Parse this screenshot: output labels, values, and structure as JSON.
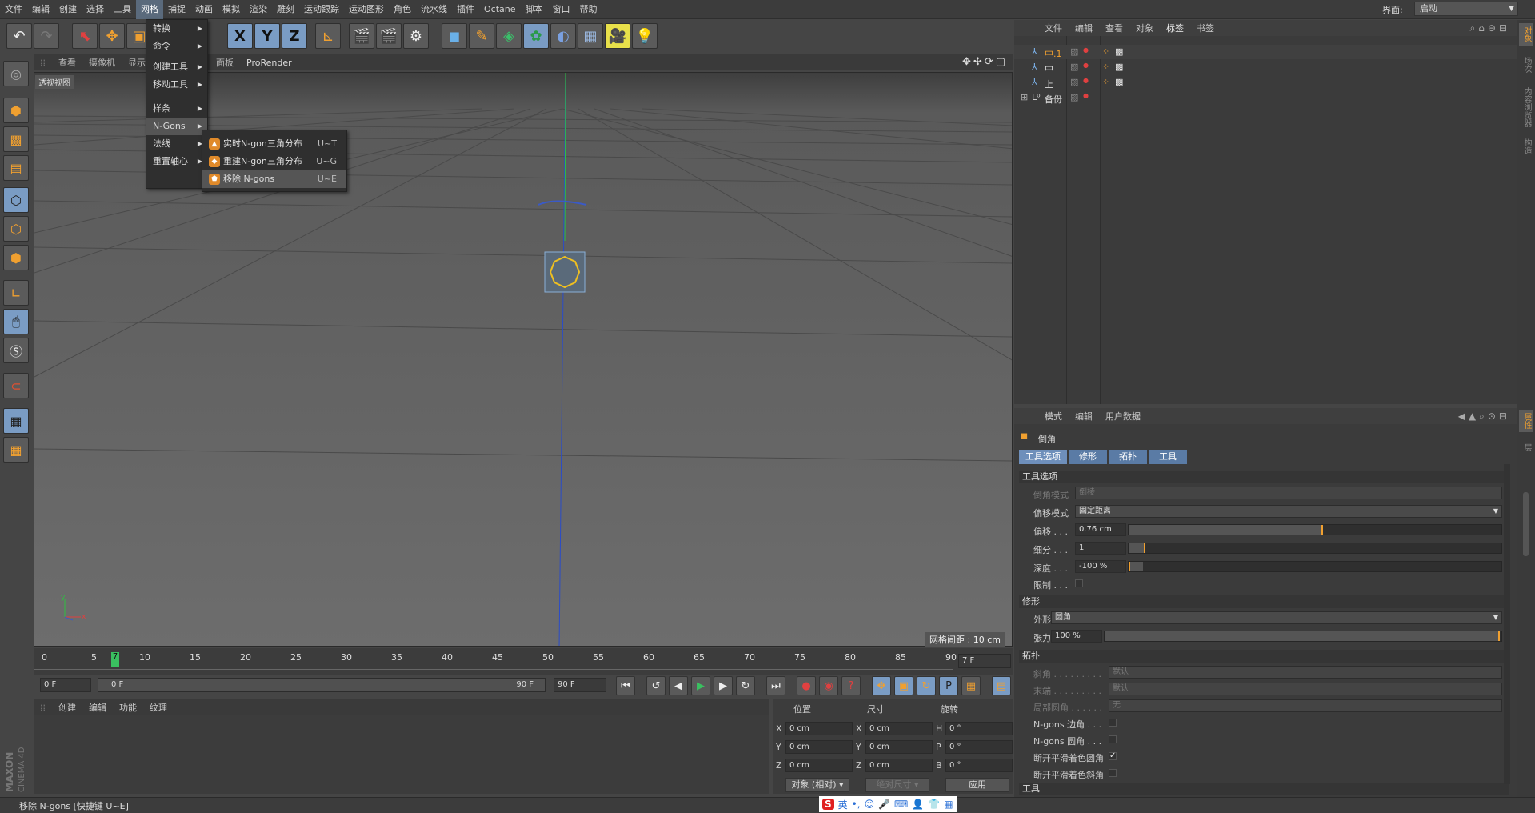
{
  "menubar": {
    "items": [
      "文件",
      "编辑",
      "创建",
      "选择",
      "工具",
      "网格",
      "捕捉",
      "动画",
      "模拟",
      "渲染",
      "雕刻",
      "运动跟踪",
      "运动图形",
      "角色",
      "流水线",
      "插件",
      "Octane",
      "脚本",
      "窗口",
      "帮助"
    ],
    "active_index": 5,
    "layout_label": "界面:",
    "layout_value": "启动"
  },
  "mesh_menu": {
    "items": [
      "转换",
      "命令",
      "创建工具",
      "移动工具",
      "样条",
      "N-Gons",
      "法线",
      "重置轴心"
    ],
    "highlight": "N-Gons"
  },
  "ngons_submenu": {
    "items": [
      {
        "label": "实时N-gon三角分布",
        "shortcut": "U~T"
      },
      {
        "label": "重建N-gon三角分布",
        "shortcut": "U~G"
      },
      {
        "label": "移除 N-gons",
        "shortcut": "U~E"
      }
    ]
  },
  "viewport": {
    "menu": [
      "查看",
      "摄像机",
      "显示",
      "面板",
      "ProRender"
    ],
    "label": "透视视图",
    "grid_info": "网格间距 : 10 cm",
    "axis_x": "x",
    "axis_y": "y"
  },
  "timeline": {
    "ticks": [
      "0",
      "5",
      "10",
      "15",
      "20",
      "25",
      "30",
      "35",
      "40",
      "45",
      "50",
      "55",
      "60",
      "65",
      "70",
      "75",
      "80",
      "85",
      "90"
    ],
    "current_marker": "7",
    "current_frame": "7 F",
    "start": "0 F",
    "range_start": "0 F",
    "range_end": "90 F",
    "end": "90 F"
  },
  "material_panel": {
    "menu": [
      "创建",
      "编辑",
      "功能",
      "纹理"
    ]
  },
  "coord_panel": {
    "headers": [
      "位置",
      "尺寸",
      "旋转"
    ],
    "pos": {
      "x": "0 cm",
      "y": "0 cm",
      "z": "0 cm"
    },
    "size": {
      "x": "0 cm",
      "y": "0 cm",
      "z": "0 cm"
    },
    "rot": {
      "h": "0 °",
      "p": "0 °",
      "b": "0 °"
    },
    "axis_labels": {
      "x": "X",
      "y": "Y",
      "z": "Z",
      "h": "H",
      "p": "P",
      "b": "B"
    },
    "mode_select": "对象 (相对)",
    "size_select": "绝对尺寸",
    "apply": "应用"
  },
  "object_manager": {
    "menu": [
      "文件",
      "编辑",
      "查看",
      "对象",
      "标签",
      "书签"
    ],
    "objects": [
      {
        "name": "中.1",
        "selected": true
      },
      {
        "name": "中",
        "selected": false
      },
      {
        "name": "上",
        "selected": false
      },
      {
        "name": "备份",
        "selected": false
      }
    ]
  },
  "attribute_manager": {
    "menu": [
      "模式",
      "编辑",
      "用户数据"
    ],
    "title": "倒角",
    "tabs": [
      "工具选项",
      "修形",
      "拓扑",
      "工具"
    ],
    "sections": {
      "tool_options": "工具选项",
      "shaping": "修形",
      "topology": "拓扑",
      "tool": "工具"
    },
    "params": {
      "bevel_mode_label": "倒角模式",
      "bevel_mode_value": "倒棱",
      "offset_mode_label": "偏移模式",
      "offset_mode_value": "固定距离",
      "offset_label": "偏移 . . .",
      "offset_value": "0.76 cm",
      "offset_fraction": 0.52,
      "subdiv_label": "细分 . . .",
      "subdiv_value": "1",
      "subdiv_fraction": 0.04,
      "depth_label": "深度 . . .",
      "depth_value": "-100 %",
      "depth_fraction": 0.0,
      "limit_label": "限制 . . .",
      "shape_label": "外形",
      "shape_value": "圆角",
      "tension_label": "张力",
      "tension_value": "100 %",
      "tension_fraction": 1.0,
      "miter_label": "斜角 . . . . . . . . .",
      "miter_value": "默认",
      "end_label": "末端 . . . . . . . . .",
      "end_value": "默认",
      "partial_label": "局部圆角 . . . . . .",
      "partial_value": "无",
      "ngons_corner_label": "N-gons 边角 . . .",
      "ngons_round_label": "N-gons 圆角 . . .",
      "break_phong_round_label": "断开平滑着色圆角",
      "break_phong_round_checked": true,
      "break_phong_miter_label": "断开平滑着色斜角"
    }
  },
  "right_strip": {
    "top_tabs": [
      "对象",
      "场次",
      "内容浏览器",
      "构造"
    ],
    "bottom_tabs": [
      "属性",
      "层"
    ]
  },
  "status": {
    "text": "移除 N-gons [快捷键 U~E]",
    "ime": "英"
  },
  "brand": {
    "maxon": "MAXON",
    "product": "CINEMA 4D"
  },
  "colors": {
    "accent": "#f0a030",
    "highlight_blue": "#7a9cc4",
    "tab_blue": "#5a7ba5"
  }
}
